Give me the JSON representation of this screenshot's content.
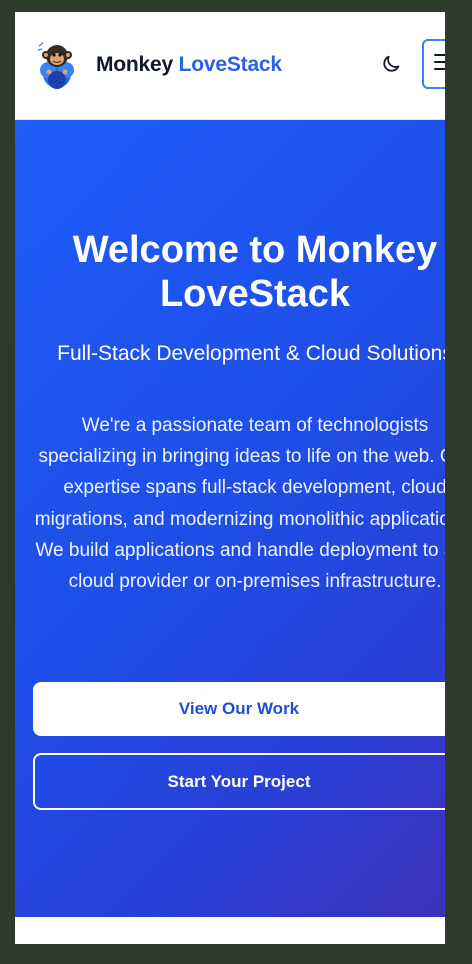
{
  "header": {
    "brand_first": "Monkey",
    "brand_second": "LoveStack",
    "logo_icon": "monkey-logo",
    "theme_icon": "moon-icon",
    "menu_icon": "hamburger-icon"
  },
  "hero": {
    "title": "Welcome to Monkey LoveStack",
    "subtitle": "Full-Stack Development & Cloud Solutions",
    "description": "We're a passionate team of technologists specializing in bringing ideas to life on the web. Our expertise spans full-stack development, cloud migrations, and modernizing monolithic applications. We build applications and handle deployment to any cloud provider or on-premises infrastructure.",
    "primary_button": "View Our Work",
    "secondary_button": "Start Your Project"
  },
  "colors": {
    "accent": "#2563eb",
    "hero_gradient_start": "#1e5cf6",
    "hero_gradient_end": "#3f2fb4",
    "background": "#2e3a2c"
  }
}
